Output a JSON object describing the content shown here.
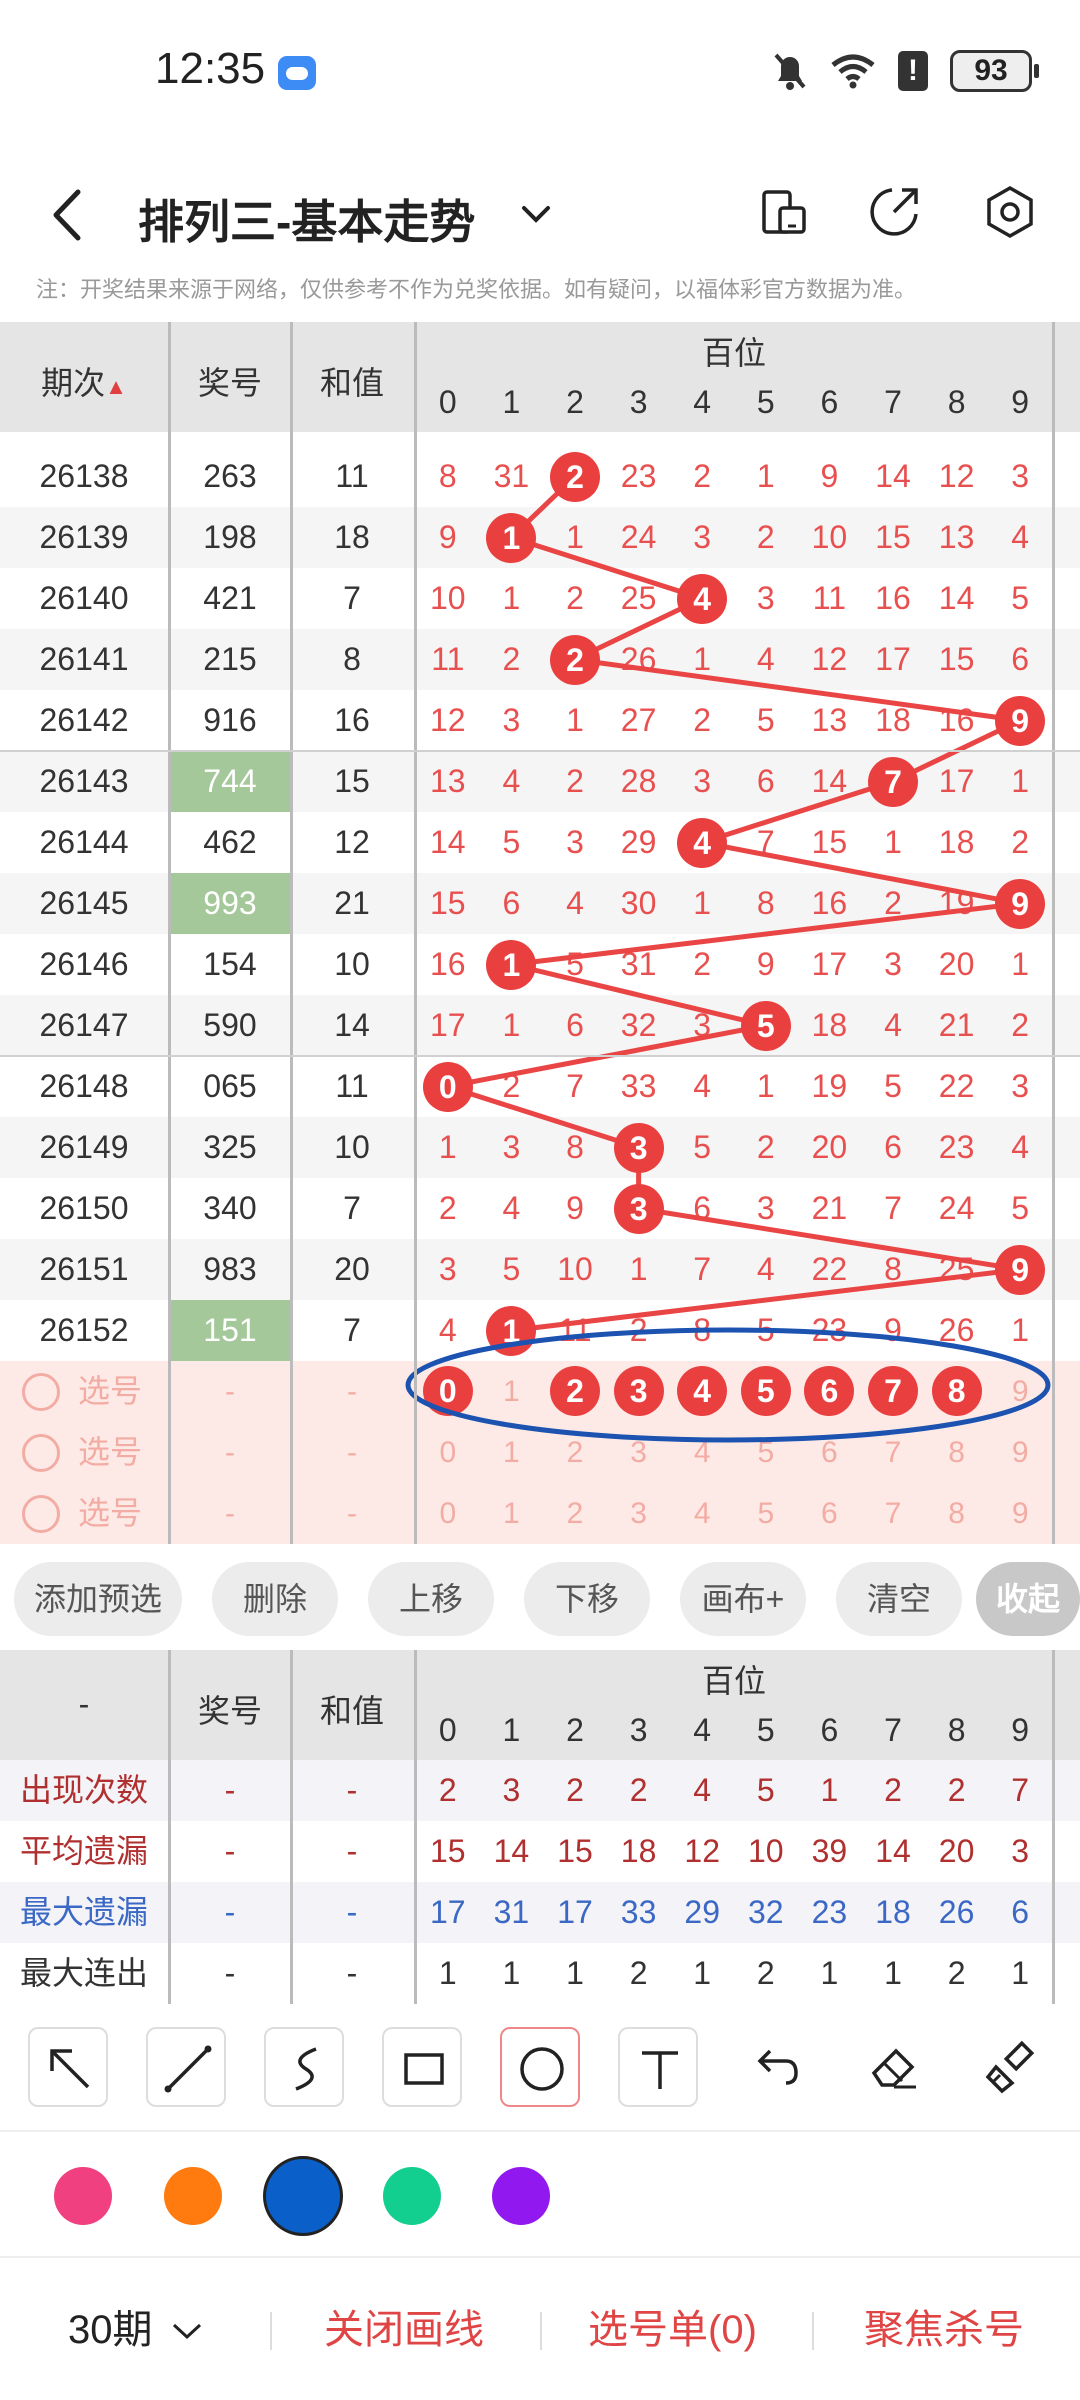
{
  "status_bar": {
    "time": "12:35",
    "battery": "93"
  },
  "header": {
    "title": "排列三-基本走势"
  },
  "note": "注：开奖结果来源于网络，仅供参考不作为兑奖依据。如有疑问，以福体彩官方数据为准。",
  "table": {
    "col_issue": "期次",
    "col_prize": "奖号",
    "col_sum": "和值",
    "group_label": "百位",
    "digits": [
      "0",
      "1",
      "2",
      "3",
      "4",
      "5",
      "6",
      "7",
      "8",
      "9"
    ],
    "rows": [
      {
        "issue": "26138",
        "prize": "263",
        "sum": "11",
        "highlight": false,
        "hit": 2,
        "cells": [
          "8",
          "31",
          "2",
          "23",
          "2",
          "1",
          "9",
          "14",
          "12",
          "3"
        ]
      },
      {
        "issue": "26139",
        "prize": "198",
        "sum": "18",
        "highlight": false,
        "hit": 1,
        "cells": [
          "9",
          "1",
          "1",
          "24",
          "3",
          "2",
          "10",
          "15",
          "13",
          "4"
        ]
      },
      {
        "issue": "26140",
        "prize": "421",
        "sum": "7",
        "highlight": false,
        "hit": 4,
        "cells": [
          "10",
          "1",
          "2",
          "25",
          "4",
          "3",
          "11",
          "16",
          "14",
          "5"
        ]
      },
      {
        "issue": "26141",
        "prize": "215",
        "sum": "8",
        "highlight": false,
        "hit": 2,
        "cells": [
          "11",
          "2",
          "2",
          "26",
          "1",
          "4",
          "12",
          "17",
          "15",
          "6"
        ]
      },
      {
        "issue": "26142",
        "prize": "916",
        "sum": "16",
        "highlight": false,
        "hit": 9,
        "cells": [
          "12",
          "3",
          "1",
          "27",
          "2",
          "5",
          "13",
          "18",
          "16",
          "9"
        ]
      },
      {
        "issue": "26143",
        "prize": "744",
        "sum": "15",
        "highlight": true,
        "hit": 7,
        "cells": [
          "13",
          "4",
          "2",
          "28",
          "3",
          "6",
          "14",
          "7",
          "17",
          "1"
        ]
      },
      {
        "issue": "26144",
        "prize": "462",
        "sum": "12",
        "highlight": false,
        "hit": 4,
        "cells": [
          "14",
          "5",
          "3",
          "29",
          "4",
          "7",
          "15",
          "1",
          "18",
          "2"
        ]
      },
      {
        "issue": "26145",
        "prize": "993",
        "sum": "21",
        "highlight": true,
        "hit": 9,
        "cells": [
          "15",
          "6",
          "4",
          "30",
          "1",
          "8",
          "16",
          "2",
          "19",
          "9"
        ]
      },
      {
        "issue": "26146",
        "prize": "154",
        "sum": "10",
        "highlight": false,
        "hit": 1,
        "cells": [
          "16",
          "1",
          "5",
          "31",
          "2",
          "9",
          "17",
          "3",
          "20",
          "1"
        ]
      },
      {
        "issue": "26147",
        "prize": "590",
        "sum": "14",
        "highlight": false,
        "hit": 5,
        "cells": [
          "17",
          "1",
          "6",
          "32",
          "3",
          "5",
          "18",
          "4",
          "21",
          "2"
        ]
      },
      {
        "issue": "26148",
        "prize": "065",
        "sum": "11",
        "highlight": false,
        "hit": 0,
        "cells": [
          "0",
          "2",
          "7",
          "33",
          "4",
          "1",
          "19",
          "5",
          "22",
          "3"
        ]
      },
      {
        "issue": "26149",
        "prize": "325",
        "sum": "10",
        "highlight": false,
        "hit": 3,
        "cells": [
          "1",
          "3",
          "8",
          "3",
          "5",
          "2",
          "20",
          "6",
          "23",
          "4"
        ]
      },
      {
        "issue": "26150",
        "prize": "340",
        "sum": "7",
        "highlight": false,
        "hit": 3,
        "cells": [
          "2",
          "4",
          "9",
          "3",
          "6",
          "3",
          "21",
          "7",
          "24",
          "5"
        ]
      },
      {
        "issue": "26151",
        "prize": "983",
        "sum": "20",
        "highlight": false,
        "hit": 9,
        "cells": [
          "3",
          "5",
          "10",
          "1",
          "7",
          "4",
          "22",
          "8",
          "25",
          "9"
        ]
      },
      {
        "issue": "26152",
        "prize": "151",
        "sum": "7",
        "highlight": true,
        "hit": 1,
        "cells": [
          "4",
          "1",
          "11",
          "2",
          "8",
          "5",
          "23",
          "9",
          "26",
          "1"
        ]
      }
    ],
    "pick_label": "选号",
    "pick_dash": "-",
    "pick_rows": [
      {
        "selected": [
          0,
          2,
          3,
          4,
          5,
          6,
          7,
          8
        ]
      },
      {
        "selected": []
      },
      {
        "selected": []
      }
    ]
  },
  "buttons": {
    "add_preset": "添加预选",
    "delete": "删除",
    "move_up": "上移",
    "move_down": "下移",
    "canvas_plus": "画布+",
    "clear": "清空",
    "collapse": "收起"
  },
  "stats": {
    "col_label": "-",
    "col_prize": "奖号",
    "col_sum": "和值",
    "group_label": "百位",
    "rows": [
      {
        "label": "出现次数",
        "color": "#b0302f",
        "values": [
          "2",
          "3",
          "2",
          "2",
          "4",
          "5",
          "1",
          "2",
          "2",
          "7"
        ]
      },
      {
        "label": "平均遗漏",
        "color": "#b0302f",
        "values": [
          "15",
          "14",
          "15",
          "18",
          "12",
          "10",
          "39",
          "14",
          "20",
          "3"
        ]
      },
      {
        "label": "最大遗漏",
        "color": "#3a68c4",
        "values": [
          "17",
          "31",
          "17",
          "33",
          "29",
          "32",
          "23",
          "18",
          "26",
          "6"
        ]
      },
      {
        "label": "最大连出",
        "color": "#333333",
        "values": [
          "1",
          "1",
          "1",
          "2",
          "1",
          "2",
          "1",
          "1",
          "2",
          "1"
        ]
      }
    ],
    "dash": "-"
  },
  "colors": [
    "#f0407f",
    "#ff7a0f",
    "#0a5fc8",
    "#12cf8f",
    "#9218f0"
  ],
  "bottom_bar": {
    "period": "30期",
    "close_line": "关闭画线",
    "pick_list": "选号单(0)",
    "focus_kill": "聚焦杀号"
  }
}
